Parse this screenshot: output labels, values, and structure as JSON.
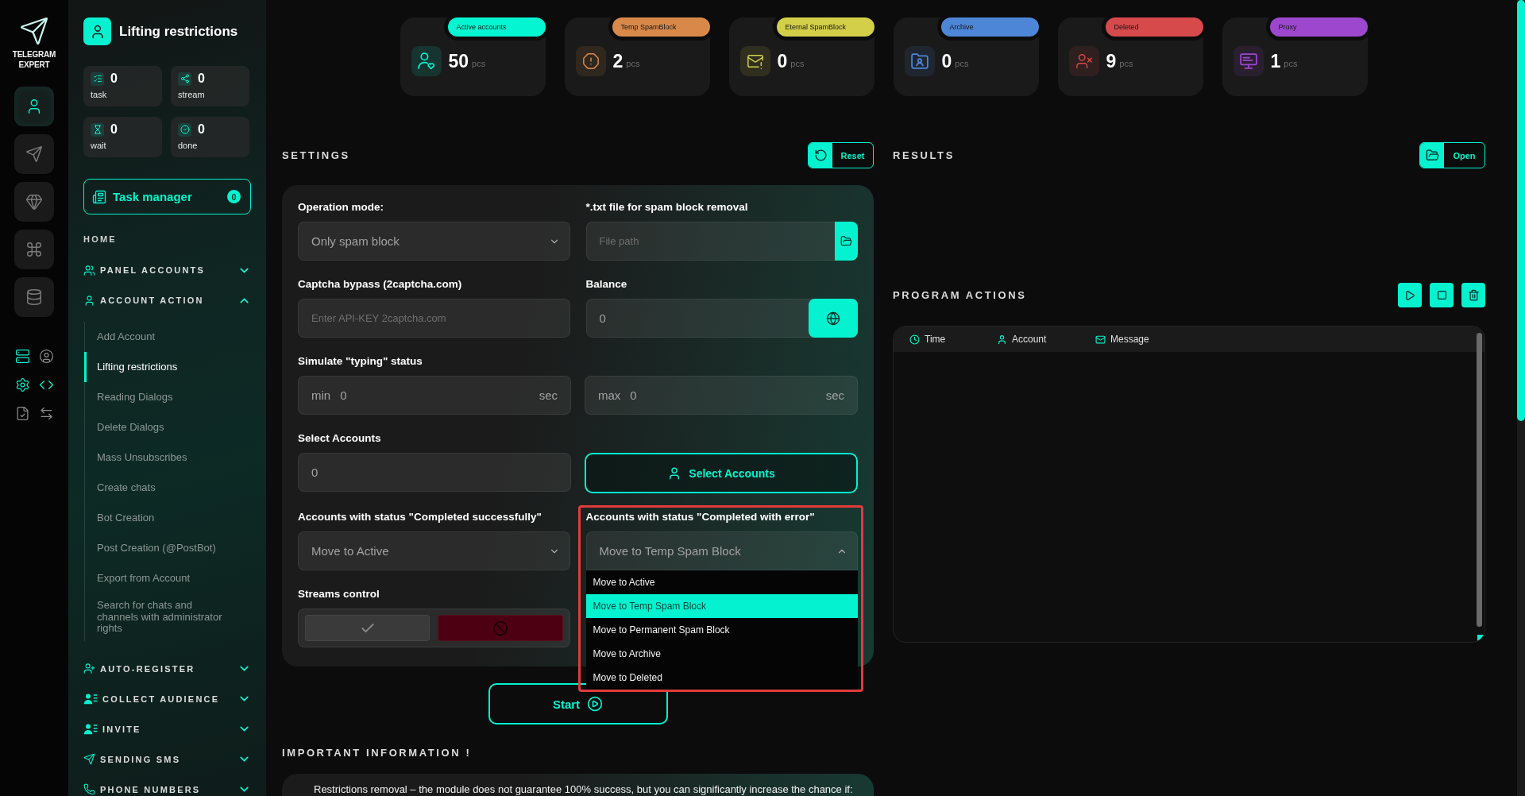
{
  "rail": {
    "logo": "TELEGRAM EXPERT",
    "items": [
      {
        "selected": true
      },
      {
        "selected": false
      },
      {
        "selected": false
      },
      {
        "selected": false
      },
      {
        "selected": false
      }
    ],
    "tools": [
      {
        "active": true
      },
      {
        "active": false
      },
      {
        "active": true
      },
      {
        "active": true
      },
      {
        "active": false
      },
      {
        "active": false
      }
    ]
  },
  "sidebar": {
    "title": "Lifting restrictions",
    "counters": [
      {
        "value": "0",
        "label": "task"
      },
      {
        "value": "0",
        "label": "stream"
      },
      {
        "value": "0",
        "label": "wait"
      },
      {
        "value": "0",
        "label": "done"
      }
    ],
    "task_manager": {
      "label": "Task manager",
      "count": "0"
    },
    "home": "HOME",
    "sections": [
      {
        "label": "PANEL ACCOUNTS",
        "expanded": false
      },
      {
        "label": "ACCOUNT ACTION",
        "expanded": true,
        "children": [
          {
            "label": "Add Account",
            "selected": false
          },
          {
            "label": "Lifting restrictions",
            "selected": true
          },
          {
            "label": "Reading Dialogs",
            "selected": false
          },
          {
            "label": "Delete Dialogs",
            "selected": false
          },
          {
            "label": "Mass Unsubscribes",
            "selected": false
          },
          {
            "label": "Create chats",
            "selected": false
          },
          {
            "label": "Bot Creation",
            "selected": false
          },
          {
            "label": "Post Creation (@PostBot)",
            "selected": false
          },
          {
            "label": "Export from Account",
            "selected": false
          },
          {
            "label": "Search for chats and channels with administrator rights",
            "selected": false
          }
        ]
      },
      {
        "label": "AUTO-REGISTER",
        "expanded": false
      },
      {
        "label": "COLLECT AUDIENCE",
        "expanded": false
      },
      {
        "label": "INVITE",
        "expanded": false
      },
      {
        "label": "SENDING SMS",
        "expanded": false
      },
      {
        "label": "PHONE NUMBERS",
        "expanded": false
      }
    ]
  },
  "stats": [
    {
      "label": "Active accounts",
      "value": "50",
      "unit": "pcs",
      "color": "#04f5d2"
    },
    {
      "label": "Temp SpamBlock",
      "value": "2",
      "unit": "pcs",
      "color": "#d8894a"
    },
    {
      "label": "Eternal SpamBlock",
      "value": "0",
      "unit": "pcs",
      "color": "#d3cf49"
    },
    {
      "label": "Archive",
      "value": "0",
      "unit": "pcs",
      "color": "#4d86d6"
    },
    {
      "label": "Deleted",
      "value": "9",
      "unit": "pcs",
      "color": "#d74a4c"
    },
    {
      "label": "Proxy",
      "value": "1",
      "unit": "pcs",
      "color": "#9d47cf"
    }
  ],
  "settings": {
    "title": "SETTINGS",
    "reset": "Reset",
    "operation_mode": {
      "label": "Operation mode:",
      "value": "Only spam block"
    },
    "spam_file": {
      "label": "*.txt file for spam block removal",
      "placeholder": "File path"
    },
    "captcha": {
      "label": "Captcha bypass (2captcha.com)",
      "placeholder": "Enter API-KEY 2captcha.com"
    },
    "balance": {
      "label": "Balance",
      "value": "0"
    },
    "typing": {
      "label": "Simulate \"typing\" status",
      "min": {
        "prefix": "min",
        "value": "0",
        "unit": "sec"
      },
      "max": {
        "prefix": "max",
        "value": "0",
        "unit": "sec"
      }
    },
    "select_accounts": {
      "label": "Select Accounts",
      "value": "0",
      "button": "Select Accounts"
    },
    "success_status": {
      "label": "Accounts with status \"Completed successfully\"",
      "value": "Move to Active"
    },
    "error_status": {
      "label": "Accounts with status \"Completed with error\"",
      "value": "Move to Temp Spam Block",
      "expanded": true,
      "highlighted": true,
      "options": [
        {
          "label": "Move to Active",
          "selected": false
        },
        {
          "label": "Move to Temp Spam Block",
          "selected": true
        },
        {
          "label": "Move to Permanent Spam Block",
          "selected": false
        },
        {
          "label": "Move to Archive",
          "selected": false
        },
        {
          "label": "Move to Deleted",
          "selected": false
        }
      ]
    },
    "streams_control": {
      "label": "Streams control",
      "options": [
        {
          "kind": "resume",
          "selected": false
        },
        {
          "kind": "stop",
          "selected": true
        }
      ]
    },
    "start": "Start"
  },
  "info": {
    "title": "IMPORTANT INFORMATION !",
    "text": "Restrictions removal – the module does not guarantee 100% success, but you can significantly increase the chance if:"
  },
  "results": {
    "title": "RESULTS",
    "open": "Open"
  },
  "program_actions": {
    "title": "PROGRAM ACTIONS",
    "columns": [
      "Time",
      "Account",
      "Message"
    ]
  }
}
